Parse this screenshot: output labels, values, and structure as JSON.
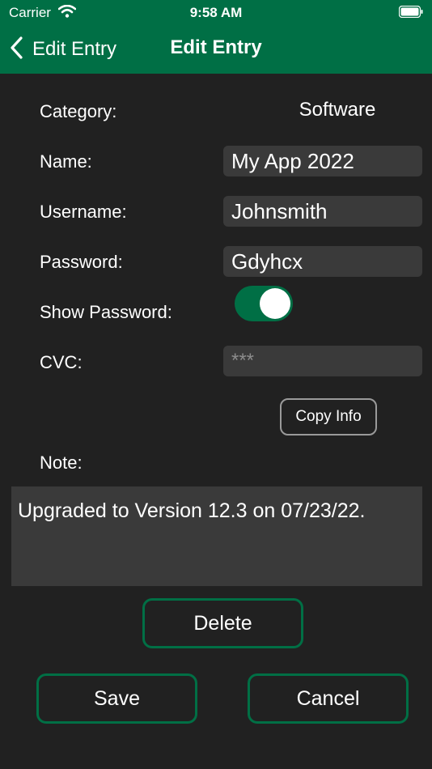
{
  "status_bar": {
    "carrier": "Carrier",
    "time": "9:58 AM"
  },
  "nav": {
    "back_label": "Edit Entry",
    "title": "Edit Entry"
  },
  "form": {
    "category_label": "Category:",
    "category_value": "Software",
    "name_label": "Name:",
    "name_value": "My App 2022",
    "username_label": "Username:",
    "username_value": "Johnsmith",
    "password_label": "Password:",
    "password_value": "Gdyhcx",
    "show_password_label": "Show Password:",
    "show_password_on": true,
    "cvc_label": "CVC:",
    "cvc_placeholder": "***",
    "copy_info_label": "Copy Info",
    "note_label": "Note:",
    "note_value": "Upgraded to Version 12.3 on 07/23/22."
  },
  "actions": {
    "delete_label": "Delete",
    "save_label": "Save",
    "cancel_label": "Cancel"
  },
  "colors": {
    "accent": "#006f45",
    "background": "#212121",
    "field": "#3a3a3a"
  }
}
